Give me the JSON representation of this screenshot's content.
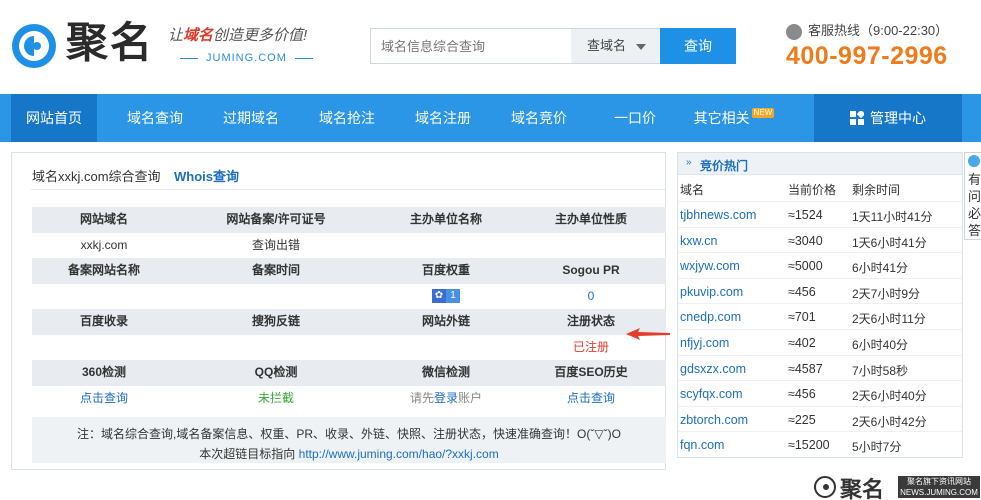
{
  "header": {
    "logo_text": "聚名",
    "slogan_prefix": "让",
    "slogan_highlight": "域名",
    "slogan_suffix": "创造更多价值!",
    "slogan_sub": "JUMING.COM",
    "search_placeholder": "域名信息综合查询",
    "search_type": "查域名",
    "search_button": "查询",
    "hotline_label": "客服热线（9:00-22:30）",
    "hotline_number": "400-997-2996"
  },
  "nav": {
    "items": [
      {
        "label": "网站首页"
      },
      {
        "label": "域名查询"
      },
      {
        "label": "过期域名"
      },
      {
        "label": "域名抢注"
      },
      {
        "label": "域名注册"
      },
      {
        "label": "域名竞价"
      },
      {
        "label": "一口价"
      },
      {
        "label": "其它相关"
      }
    ],
    "new_badge": "NEW",
    "manage": "管理中心"
  },
  "left": {
    "title": "域名xxkj.com综合查询",
    "whois": "Whois查询",
    "rows": [
      {
        "cells": [
          "网站域名",
          "网站备案/许可证号",
          "主办单位名称",
          "主办单位性质"
        ],
        "head": true
      },
      {
        "cells": [
          "xxkj.com",
          "查询出错",
          "",
          ""
        ]
      },
      {
        "cells": [
          "备案网站名称",
          "备案时间",
          "百度权重",
          "Sogou PR"
        ],
        "head": true
      },
      {
        "cells": [
          "",
          "",
          "",
          "0"
        ]
      },
      {
        "cells": [
          "百度收录",
          "搜狗反链",
          "网站外链",
          "注册状态"
        ],
        "head": true
      },
      {
        "cells": [
          "",
          "",
          "",
          "已注册"
        ]
      },
      {
        "cells": [
          "360检测",
          "QQ检测",
          "微信检测",
          "百度SEO历史"
        ],
        "head": true
      },
      {
        "cells": [
          "点击查询",
          "未拦截",
          "",
          "点击查询"
        ]
      }
    ],
    "baidu_weight": "1",
    "wechat_prefix": "请先",
    "wechat_link": "登录",
    "wechat_suffix": "账户",
    "note_line1": "注：域名综合查询,域名备案信息、权重、PR、收录、外链、快照、注册状态，快速准确查询！O(ˇ▽ˇ)O",
    "note_line2_prefix": "本次超链目标指向",
    "note_line2_link": "http://www.juming.com/hao/?xxkj.com"
  },
  "right": {
    "dbl": "»",
    "title": "竞价热门",
    "col_domain": "域名",
    "col_price": "当前价格",
    "col_time": "剩余时间",
    "rows": [
      {
        "domain": "tjbhnews.com",
        "price": "≈1524",
        "time": "1天11小时41分"
      },
      {
        "domain": "kxw.cn",
        "price": "≈3040",
        "time": "1天6小时41分"
      },
      {
        "domain": "wxjyw.com",
        "price": "≈5000",
        "time": "6小时41分"
      },
      {
        "domain": "pkuvip.com",
        "price": "≈456",
        "time": "2天7小时9分"
      },
      {
        "domain": "cnedp.com",
        "price": "≈701",
        "time": "2天6小时11分"
      },
      {
        "domain": "nfjyj.com",
        "price": "≈402",
        "time": "6小时40分"
      },
      {
        "domain": "gdsxzx.com",
        "price": "≈4587",
        "time": "7小时58秒"
      },
      {
        "domain": "scyfqx.com",
        "price": "≈456",
        "time": "2天6小时40分"
      },
      {
        "domain": "zbtorch.com",
        "price": "≈225",
        "time": "2天6小时42分"
      },
      {
        "domain": "fqn.com",
        "price": "≈15200",
        "time": "5小时7分"
      }
    ],
    "side_tab": "有问必答"
  },
  "watermark": {
    "logo": "聚名",
    "line1": "聚名旗下资讯网站",
    "line2": "NEWS.JUMING.COM"
  },
  "colors": {
    "nav_bg": "#2b95e6",
    "nav_active": "#1677c8",
    "hotline": "#f07b1a",
    "link": "#1c6fbf",
    "status_red": "#e53b2c"
  }
}
